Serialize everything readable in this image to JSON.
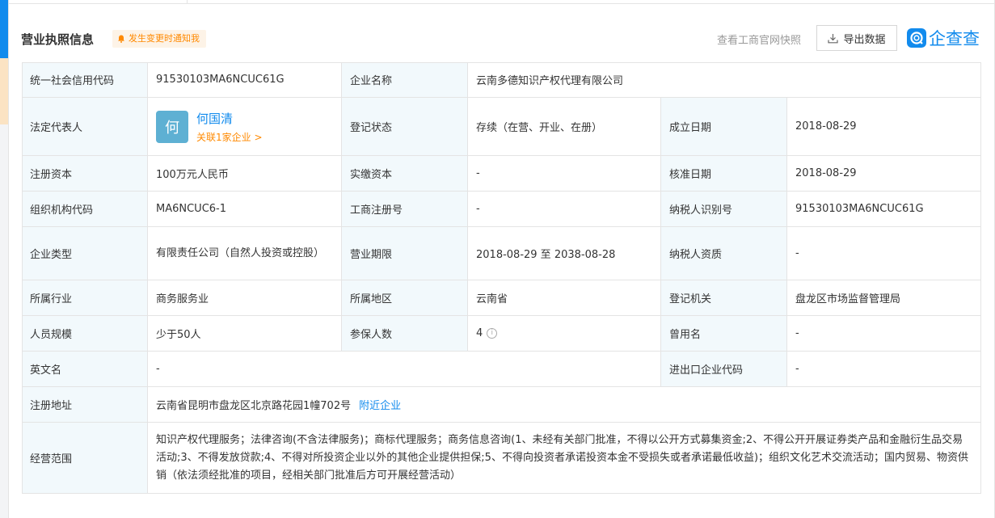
{
  "section": {
    "title": "营业执照信息",
    "notify_label": "发生变更时通知我",
    "snapshot_link": "查看工商官网快照",
    "export_label": "导出数据",
    "logo_text": "企查查"
  },
  "colors": {
    "accent": "#128bed",
    "label_bg": "#f2f9fc",
    "orange": "#ff8900",
    "avatar_bg": "#5eb0d3"
  },
  "icons": {
    "notify": "bell-icon",
    "export": "download-icon",
    "logo": "qcc-logo-icon",
    "info": "info-circle-icon"
  },
  "rows": {
    "r1": {
      "l1": "统一社会信用代码",
      "v1": "91530103MA6NCUC61G",
      "l2": "企业名称",
      "v2": "云南多德知识产权代理有限公司"
    },
    "r2": {
      "l1": "法定代表人",
      "avatar_char": "何",
      "rep_name": "何国清",
      "rep_link": "关联1家企业 >",
      "l2": "登记状态",
      "v2": "存续（在营、开业、在册）",
      "l3": "成立日期",
      "v3": "2018-08-29"
    },
    "r3": {
      "l1": "注册资本",
      "v1": "100万元人民币",
      "l2": "实缴资本",
      "v2": "-",
      "l3": "核准日期",
      "v3": "2018-08-29"
    },
    "r4": {
      "l1": "组织机构代码",
      "v1": "MA6NCUC6-1",
      "l2": "工商注册号",
      "v2": "-",
      "l3": "纳税人识别号",
      "v3": "91530103MA6NCUC61G"
    },
    "r5": {
      "l1": "企业类型",
      "v1": "有限责任公司（自然人投资或控股）",
      "l2": "营业期限",
      "v2": "2018-08-29 至 2038-08-28",
      "l3": "纳税人资质",
      "v3": "-"
    },
    "r6": {
      "l1": "所属行业",
      "v1": "商务服务业",
      "l2": "所属地区",
      "v2": "云南省",
      "l3": "登记机关",
      "v3": "盘龙区市场监督管理局"
    },
    "r7": {
      "l1": "人员规模",
      "v1": "少于50人",
      "l2": "参保人数",
      "v2": "4",
      "l3": "曾用名",
      "v3": "-"
    },
    "r8": {
      "l1": "英文名",
      "v1": "-",
      "l3": "进出口企业代码",
      "v3": "-"
    },
    "r9": {
      "l1": "注册地址",
      "v1": "云南省昆明市盘龙区北京路花园1幢702号",
      "link": "附近企业"
    },
    "r10": {
      "l1": "经营范围",
      "v1": "知识产权代理服务；法律咨询(不含法律服务)；商标代理服务；商务信息咨询(1、未经有关部门批准，不得以公开方式募集资金;2、不得公开开展证券类产品和金融衍生品交易活动;3、不得发放贷款;4、不得对所投资企业以外的其他企业提供担保;5、不得向投资者承诺投资本金不受损失或者承诺最低收益)；组织文化艺术交流活动；国内贸易、物资供销（依法须经批准的项目，经相关部门批准后方可开展经营活动）"
    }
  }
}
